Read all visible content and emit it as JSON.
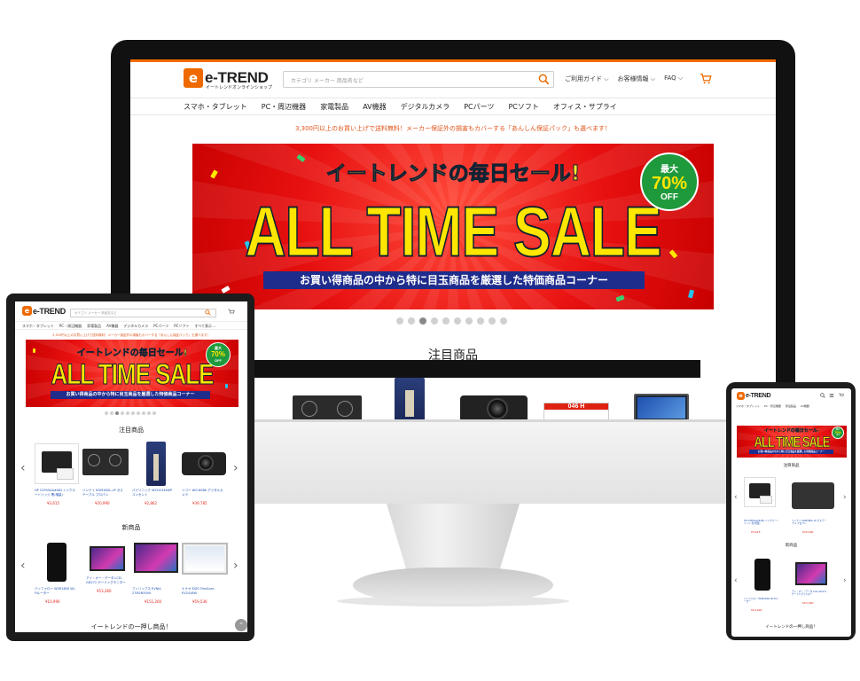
{
  "brand": {
    "logo_mark": "e",
    "name": "e-TREND",
    "tagline": "イートレンドオンラインショップ",
    "accent": "#ee6a00",
    "sale_red": "#e71010",
    "price_red": "#e0251b"
  },
  "header": {
    "search_placeholder": "カテゴリ メーカー 商品名など",
    "links": [
      "ご利用ガイド ⌵",
      "お客様情報 ⌵",
      "FAQ ⌵"
    ]
  },
  "nav": [
    "スマホ・タブレット",
    "PC・周辺機器",
    "家電製品",
    "AV機器",
    "デジタルカメラ",
    "PCパーツ",
    "PCソフト",
    "オフィス・サプライ"
  ],
  "tablet_nav_more": "すべて表示 ⌵",
  "notice": "3,300円以上のお買い上げで送料無料！メーカー保証外の損害もカバーする「あんしん保証パック」も選べます！",
  "banner": {
    "top_line": "イートレンドの毎日セール!",
    "main": "ALL TIME SALE",
    "sub": "お買い得商品の中から特に目玉商品を厳選した特価商品コーナー",
    "badge_top": "最大",
    "badge_value": "70%",
    "badge_bottom": "OFF"
  },
  "sections": {
    "featured": "注目商品",
    "new_arrivals": "新商品",
    "recommend": "イートレンドの一押し商品！"
  },
  "featured_products": [
    {
      "name": "HP C2P05AA#ABJ インクカートリッジ 黒(増量)",
      "price": "¥3,615"
    },
    {
      "name": "リンナイ KGM1BGL-LP ガステーブル プロパン",
      "price": "¥20,990"
    },
    {
      "name": "パナソニック WCH2434WP コンセント",
      "price": "¥2,862"
    },
    {
      "name": "リコー WG-80BK デジタルカメラ",
      "price": "¥39,785"
    }
  ],
  "toner_label": "046 H",
  "new_products": [
    {
      "name": "バッファロー WSR1800 Wi-Fiルーター",
      "price": "¥10,990"
    },
    {
      "name": "アイ・オー・データ LCD-GD271 ゲーミングモニター",
      "price": "¥53,360"
    },
    {
      "name": "フィリップス EVNIA 27M2N5500",
      "price": "¥151,200"
    },
    {
      "name": "ナナオ EIZO FlexScan EV2416W",
      "price": "¥59,536"
    }
  ],
  "price_suffix": "(税込)",
  "carousel": {
    "total": 10,
    "active": 2
  },
  "icons": {
    "search": "magnifier-icon",
    "cart": "cart-icon",
    "prev": "chevron-left-icon",
    "next": "chevron-right-icon",
    "top": "chevron-up-icon"
  },
  "glyphs": {
    "prev": "‹",
    "next": "›",
    "top": "⌃"
  }
}
